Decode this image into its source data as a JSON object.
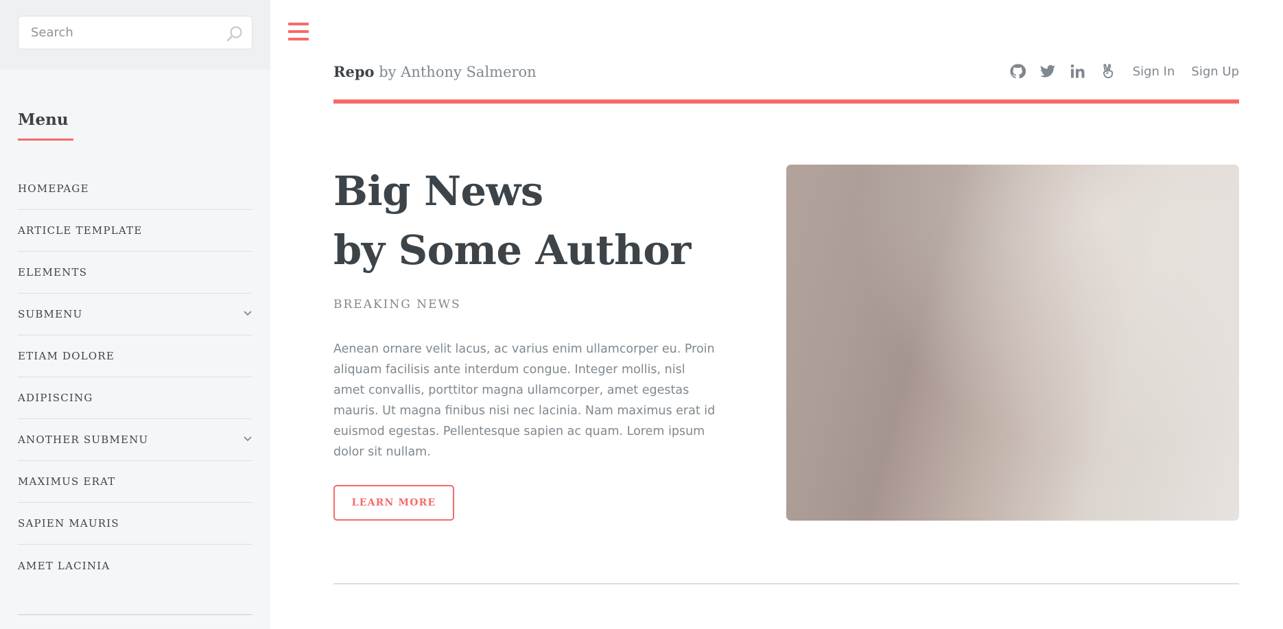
{
  "sidebar": {
    "search": {
      "placeholder": "Search",
      "value": ""
    },
    "menu_title": "Menu",
    "items": [
      {
        "label": "HOMEPAGE",
        "has_submenu": false
      },
      {
        "label": "ARTICLE TEMPLATE",
        "has_submenu": false
      },
      {
        "label": "ELEMENTS",
        "has_submenu": false
      },
      {
        "label": "SUBMENU",
        "has_submenu": true
      },
      {
        "label": "ETIAM DOLORE",
        "has_submenu": false
      },
      {
        "label": "ADIPISCING",
        "has_submenu": false
      },
      {
        "label": "ANOTHER SUBMENU",
        "has_submenu": true
      },
      {
        "label": "MAXIMUS ERAT",
        "has_submenu": false
      },
      {
        "label": "SAPIEN MAURIS",
        "has_submenu": false
      },
      {
        "label": "AMET LACINIA",
        "has_submenu": false
      }
    ]
  },
  "header": {
    "logo_strong": "Repo",
    "logo_rest": " by Anthony Salmeron",
    "icons": [
      "github-icon",
      "twitter-icon",
      "linkedin-icon",
      "angellist-icon"
    ],
    "sign_in": "Sign In",
    "sign_up": "Sign Up"
  },
  "hero": {
    "title_line1": "Big News",
    "title_line2": "by Some Author",
    "subtitle": "BREAKING NEWS",
    "body": "Aenean ornare velit lacus, ac varius enim ullamcorper eu. Proin aliquam facilisis ante interdum congue. Integer mollis, nisl amet convallis, porttitor magna ullamcorper, amet egestas mauris. Ut magna finibus nisi nec lacinia. Nam maximus erat id euismod egestas. Pellentesque sapien ac quam. Lorem ipsum dolor sit nullam.",
    "cta_label": "LEARN MORE"
  },
  "colors": {
    "accent": "#f56a6a",
    "text_dark": "#3d4449",
    "text_muted": "#7f888f",
    "sidebar_bg": "#f5f6f7"
  }
}
